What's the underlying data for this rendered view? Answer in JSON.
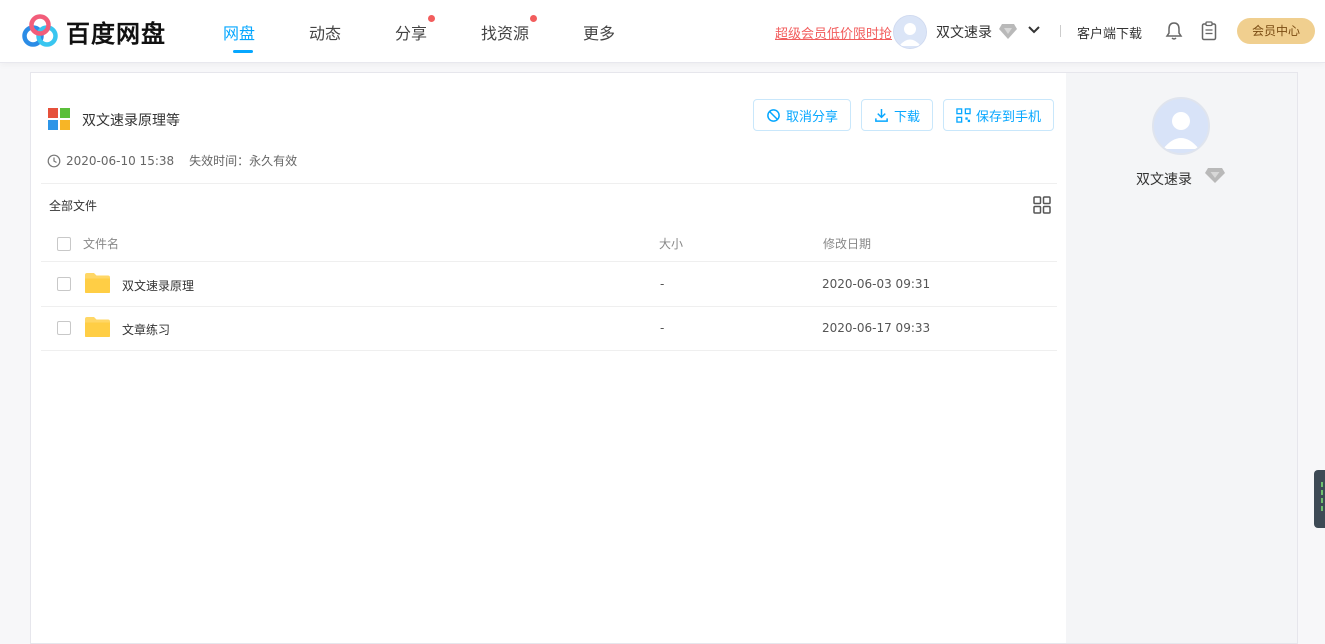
{
  "header": {
    "logo_text": "百度网盘",
    "nav": [
      {
        "label": "网盘",
        "active": true,
        "dot": false
      },
      {
        "label": "动态",
        "active": false,
        "dot": false
      },
      {
        "label": "分享",
        "active": false,
        "dot": true
      },
      {
        "label": "找资源",
        "active": false,
        "dot": true
      },
      {
        "label": "更多",
        "active": false,
        "dot": false
      }
    ],
    "promo": "超级会员低价限时抢",
    "username": "双文速录",
    "client_download": "客户端下载",
    "vip_center": "会员中心"
  },
  "share": {
    "title": "双文速录原理等",
    "cancel_share": "取消分享",
    "download": "下载",
    "save_to_phone": "保存到手机",
    "created": "2020-06-10 15:38",
    "expire": "失效时间：永久有效"
  },
  "files": {
    "breadcrumb": "全部文件",
    "columns": {
      "name": "文件名",
      "size": "大小",
      "date": "修改日期"
    },
    "rows": [
      {
        "name": "双文速录原理",
        "size": "-",
        "date": "2020-06-03 09:31"
      },
      {
        "name": "文章练习",
        "size": "-",
        "date": "2020-06-17 09:33"
      }
    ]
  },
  "side": {
    "username": "双文速录"
  },
  "colors": {
    "accent": "#06a7ff",
    "promo": "#f25d5d",
    "vip": "#f0cf8f",
    "folder": "#ffd766"
  }
}
